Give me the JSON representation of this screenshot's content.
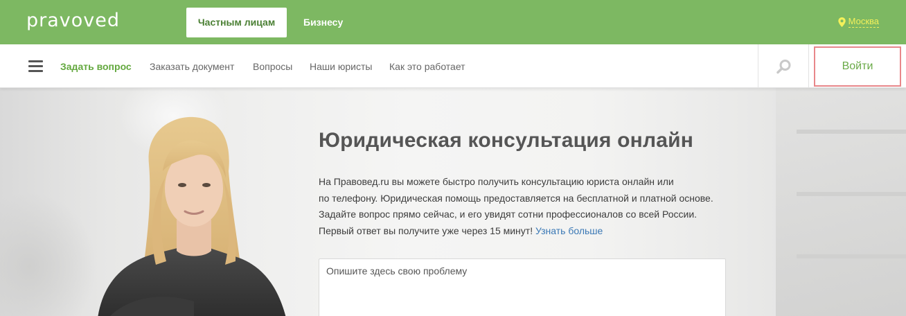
{
  "header": {
    "logo": "pravoved",
    "audience_tabs": [
      {
        "label": "Частным лицам",
        "active": true
      },
      {
        "label": "Бизнесу",
        "active": false
      }
    ],
    "city": "Москва",
    "city_icon": "map-pin-icon"
  },
  "nav": {
    "menu_icon": "hamburger-menu-icon",
    "items": [
      {
        "label": "Задать вопрос",
        "highlight": true
      },
      {
        "label": "Заказать документ"
      },
      {
        "label": "Вопросы"
      },
      {
        "label": "Наши юристы"
      },
      {
        "label": "Как это работает"
      }
    ],
    "search_icon": "search-icon",
    "login_label": "Войти"
  },
  "hero": {
    "title": "Юридическая консультация онлайн",
    "lines": [
      "На Правовед.ru вы можете быстро получить консультацию юриста онлайн или",
      "по телефону. Юридическая помощь предоставляется на бесплатной и платной основе.",
      "Задайте вопрос прямо сейчас, и его увидят сотни профессионалов со всей России.",
      "Первый ответ вы получите уже через 15 минут!"
    ],
    "learn_more": "Узнать больше",
    "question_placeholder": "Опишите здесь свою проблему"
  },
  "colors": {
    "brand_green": "#7db862",
    "nav_accent": "#63a83e",
    "city_yellow": "#f3f05a",
    "login_border": "#e8878a",
    "link_blue": "#3a78b5"
  }
}
